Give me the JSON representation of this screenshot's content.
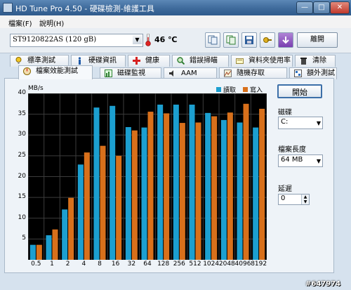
{
  "window": {
    "title": "HD Tune Pro 4.50 - 硬碟檢測-維護工具",
    "min": "—",
    "max": "□",
    "close": "✕"
  },
  "menu": [
    "檔案(F)",
    "說明(H)"
  ],
  "toolbar": {
    "drive": "ST9120822AS (120 gB)",
    "temperature": "46 ℃",
    "buttons": [
      "copy-info-icon",
      "copy-screenshot-icon",
      "save-icon",
      "settings-icon",
      "download-icon"
    ],
    "exit_label": "離開"
  },
  "tabs_row1": [
    {
      "label": "標準測試",
      "icon": "benchmark-icon"
    },
    {
      "label": "硬碟資訊",
      "icon": "info-icon"
    },
    {
      "label": "健康",
      "icon": "health-icon"
    },
    {
      "label": "錯誤掃瞄",
      "icon": "error-scan-icon"
    },
    {
      "label": "資料夾使用率",
      "icon": "folder-icon"
    },
    {
      "label": "清除",
      "icon": "erase-icon"
    }
  ],
  "tabs_row2": [
    {
      "label": "檔案效能測試",
      "icon": "file-benchmark-icon",
      "active": true
    },
    {
      "label": "磁碟監視",
      "icon": "disk-monitor-icon"
    },
    {
      "label": "AAM",
      "icon": "aam-icon"
    },
    {
      "label": "隨機存取",
      "icon": "random-access-icon"
    },
    {
      "label": "額外測試",
      "icon": "extra-tests-icon"
    }
  ],
  "controls": {
    "start_label": "開始",
    "drive_label": "磁碟",
    "drive_value": "C:",
    "file_length_label": "檔案長度",
    "file_length_value": "64 MB",
    "delay_label": "延遲",
    "delay_value": "0"
  },
  "watermark": "#647974",
  "colors": {
    "read": "#1c9fd0",
    "write": "#d8701b",
    "background": "#000000",
    "grid": "#3c3c3c"
  },
  "chart_data": {
    "type": "bar",
    "ylabel": "MB/s",
    "ylim": [
      0,
      40
    ],
    "yticks": [
      5,
      10,
      15,
      20,
      25,
      30,
      35,
      40
    ],
    "categories": [
      "0.5",
      "1",
      "2",
      "4",
      "8",
      "16",
      "32",
      "64",
      "128",
      "256",
      "512",
      "1024",
      "2048",
      "4096",
      "8192"
    ],
    "series": [
      {
        "name": "讀取",
        "values": [
          3.6,
          5.9,
          12.1,
          22.9,
          36.6,
          37.0,
          31.9,
          31.8,
          37.3,
          37.3,
          37.3,
          35.3,
          33.6,
          33.0,
          31.8
        ]
      },
      {
        "name": "寫入",
        "values": [
          3.6,
          7.3,
          14.9,
          25.8,
          27.4,
          25.0,
          31.1,
          35.6,
          35.2,
          32.9,
          33.0,
          34.5,
          35.4,
          37.5,
          36.3
        ]
      }
    ],
    "grid": true,
    "legend": "top-right"
  }
}
